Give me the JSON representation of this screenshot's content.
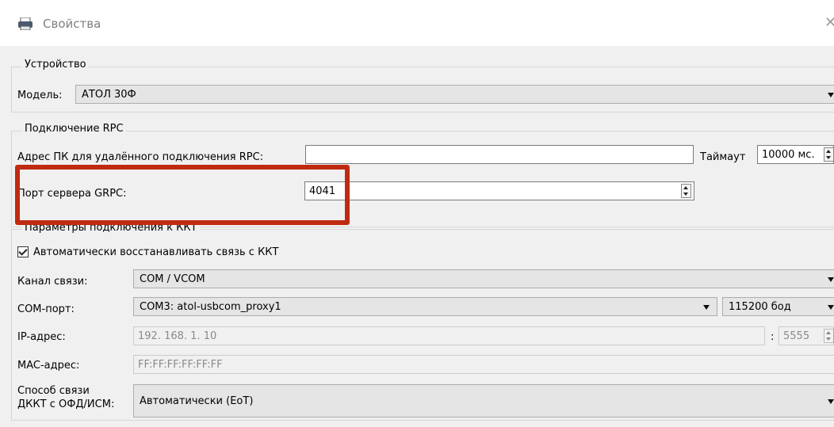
{
  "window": {
    "title": "Свойства",
    "icon": "printer-icon",
    "close": "✕"
  },
  "device": {
    "legend": "Устройство",
    "model_label": "Модель:",
    "model_value": "АТОЛ 30Ф"
  },
  "rpc": {
    "legend": "Подключение RPC",
    "address_label": "Адрес ПК для удалённого подключения RPC:",
    "address_value": "",
    "timeout_label": "Таймаут",
    "timeout_value": "10000 мс.",
    "grpc_port_label": "Порт сервера GRPC:",
    "grpc_port_value": "4041"
  },
  "kkt": {
    "legend": "Параметры подключения к ККТ",
    "auto_reconnect_label": "Автоматически восстанавливать связь с ККТ",
    "auto_reconnect_checked": true,
    "channel_label": "Канал связи:",
    "channel_value": "COM / VCOM",
    "com_port_label": "COM-порт:",
    "com_port_value": "COM3: atol-usbcom_proxy1",
    "baud_value": "115200 бод",
    "ip_label": "IP-адрес:",
    "ip_value": "192. 168. 1. 10",
    "ip_port_sep": ":",
    "ip_port_value": "5555",
    "mac_label": "MAC-адрес:",
    "mac_value": "FF:FF:FF:FF:FF:FF",
    "ofd_label_line1": "Способ связи",
    "ofd_label_line2": "ДККТ с ОФД/ИСМ:",
    "ofd_value": "Автоматически (EoT)"
  },
  "colors": {
    "highlight": "#c02a10",
    "background": "#f0f0f0"
  }
}
